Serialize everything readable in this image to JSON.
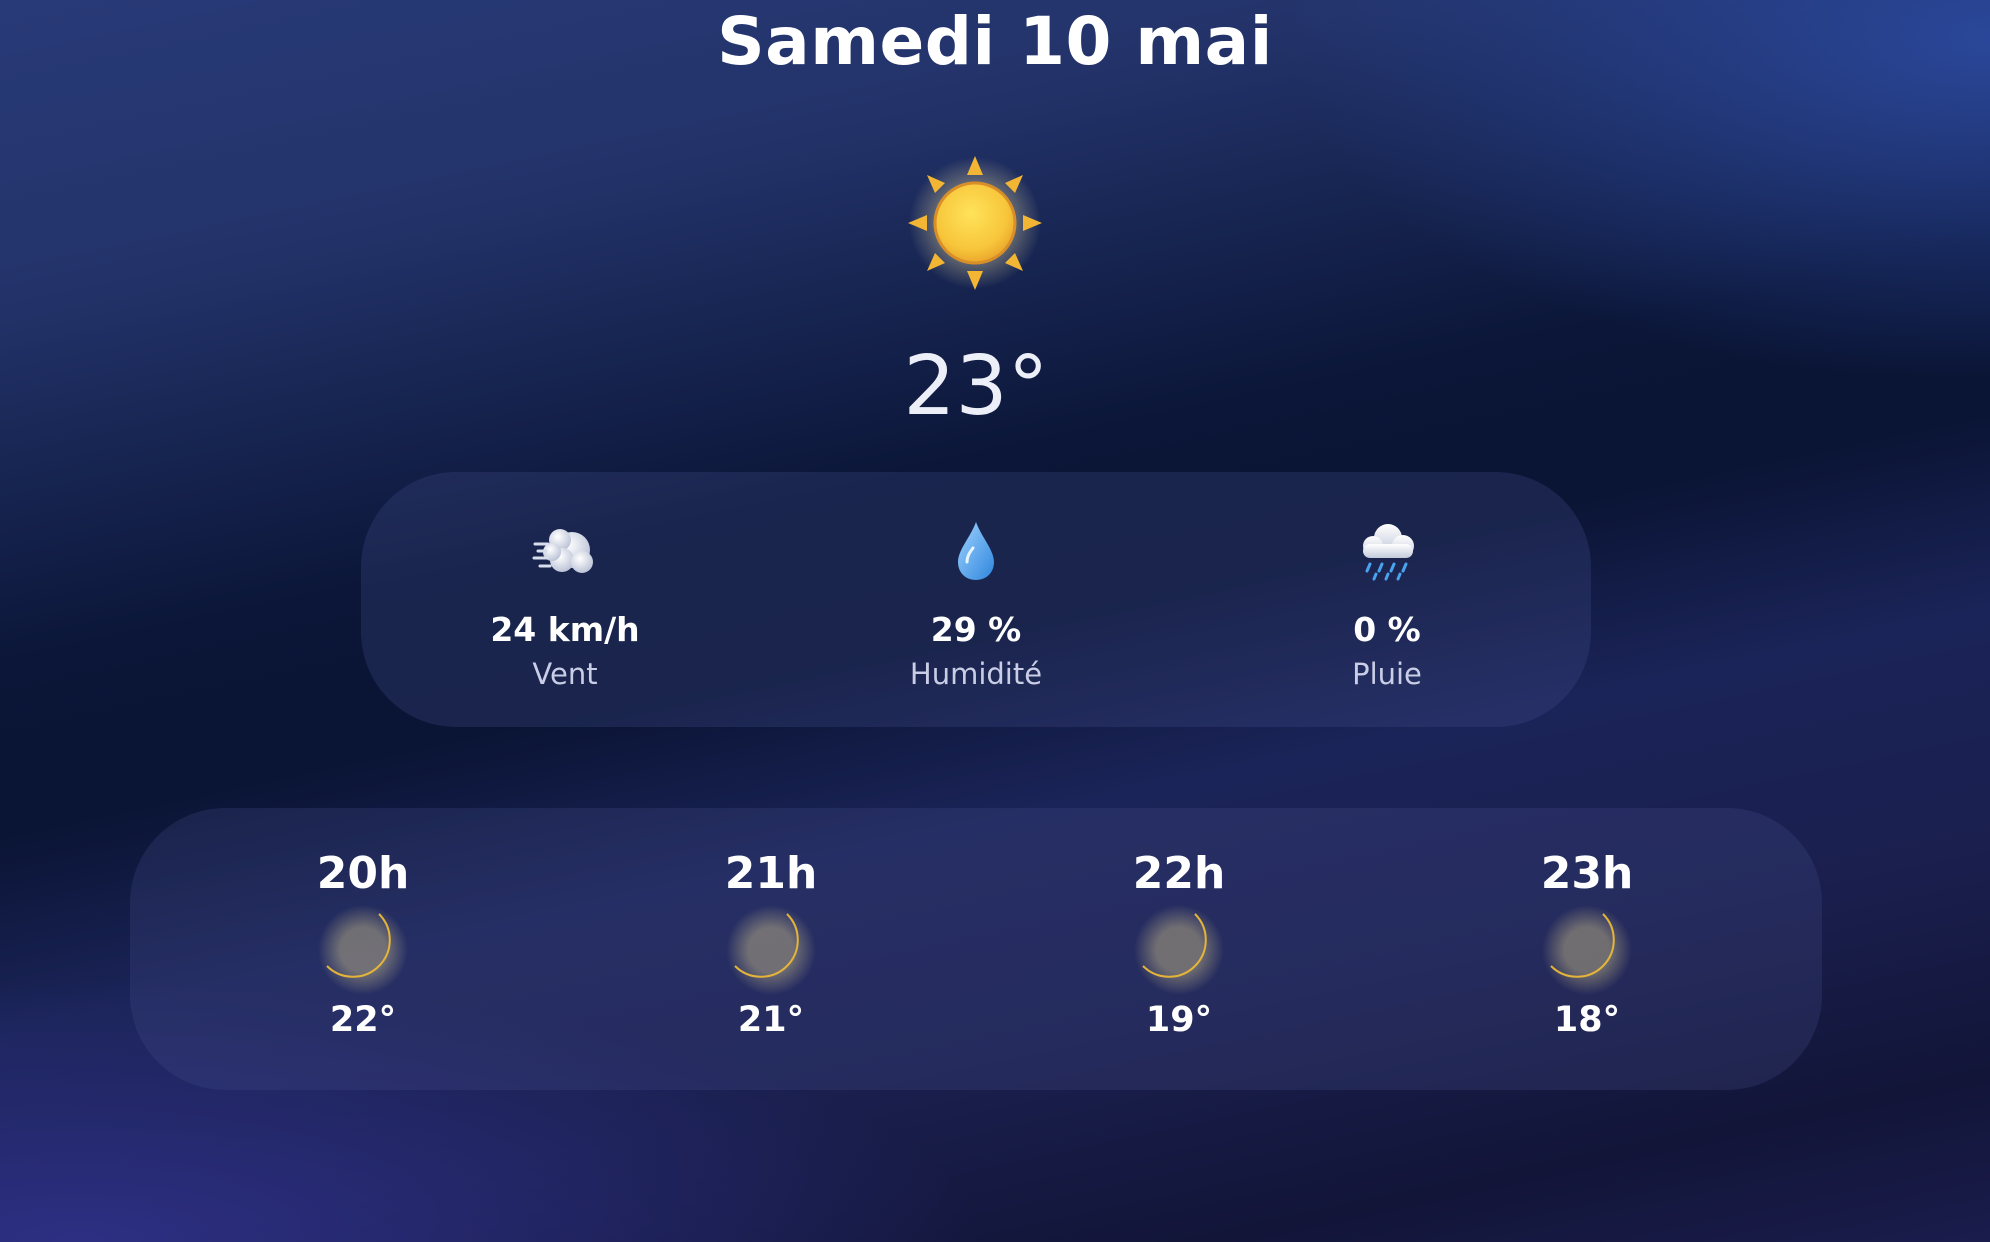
{
  "header": {
    "title": "Samedi 10 mai"
  },
  "current": {
    "icon": "sun-icon",
    "temperature": "23°"
  },
  "stats": [
    {
      "icon": "wind-icon",
      "value": "24 km/h",
      "label": "Vent"
    },
    {
      "icon": "droplet-icon",
      "value": "29 %",
      "label": "Humidité"
    },
    {
      "icon": "rain-cloud-icon",
      "value": "0 %",
      "label": "Pluie"
    }
  ],
  "hourly": [
    {
      "hour": "20h",
      "icon": "crescent-moon-icon",
      "temp": "22°"
    },
    {
      "hour": "21h",
      "icon": "crescent-moon-icon",
      "temp": "21°"
    },
    {
      "hour": "22h",
      "icon": "crescent-moon-icon",
      "temp": "19°"
    },
    {
      "hour": "23h",
      "icon": "crescent-moon-icon",
      "temp": "18°"
    }
  ],
  "colors": {
    "sun": "#f7c53a",
    "moon": "#f5d65a",
    "drop": "#4aa3ef",
    "label": "#c9cde6"
  }
}
